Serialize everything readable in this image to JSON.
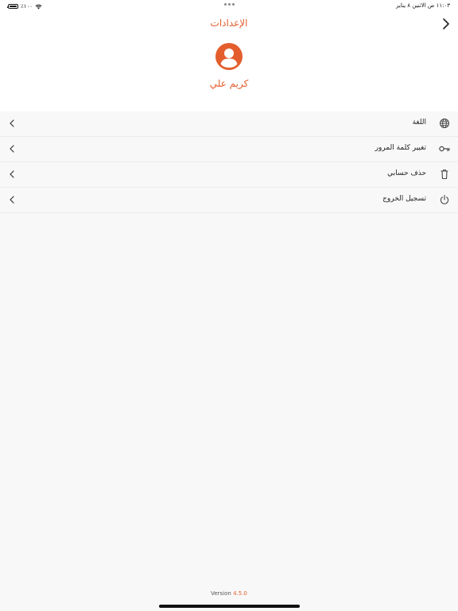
{
  "status_bar": {
    "time_date": "١١:٠٣ ص   الاثنين ٨ يناير",
    "battery_text": "٪١٠٠"
  },
  "header": {
    "title": "الإعدادات",
    "user_name": "كريم علي"
  },
  "menu": {
    "items": [
      {
        "label": "اللغة",
        "icon": "globe-icon"
      },
      {
        "label": "تغيير كلمة المرور",
        "icon": "key-icon"
      },
      {
        "label": "حذف حسابي",
        "icon": "trash-icon"
      },
      {
        "label": "تسجيل الخروج",
        "icon": "power-icon"
      }
    ]
  },
  "footer": {
    "version_label": "Version",
    "version_number": "4.5.0"
  },
  "colors": {
    "accent": "#e45e2d"
  }
}
